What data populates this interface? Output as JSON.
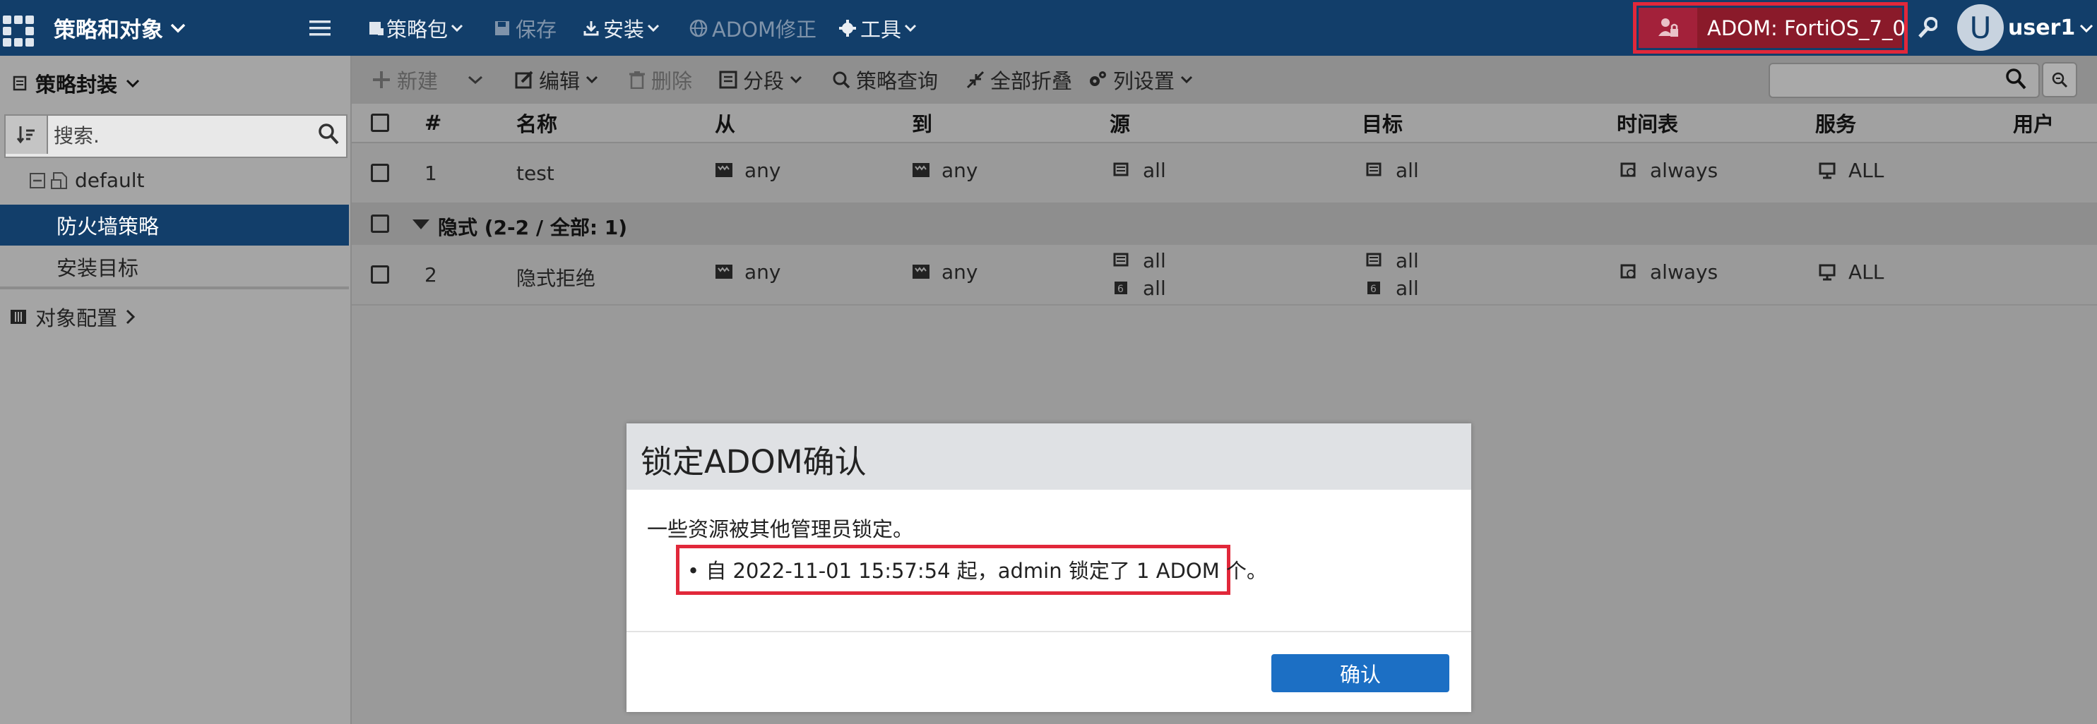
{
  "app": {
    "title": "策略和对象",
    "adom_label": "ADOM: FortiOS_7_0",
    "user_initial": "U",
    "user_name": "user1"
  },
  "topnav": {
    "policy_package": "策略包",
    "save": "保存",
    "install": "安装",
    "adom_revision": "ADOM修正",
    "tools": "工具"
  },
  "sidebar": {
    "header": "策略封装",
    "search_placeholder": "搜索.",
    "tree_default": "default",
    "items": [
      {
        "label": "防火墙策略",
        "active": true
      },
      {
        "label": "安装目标",
        "active": false
      }
    ],
    "object_config": "对象配置"
  },
  "toolbar": {
    "new": "新建",
    "edit": "编辑",
    "delete": "删除",
    "section": "分段",
    "policy_lookup": "策略查询",
    "collapse_all": "全部折叠",
    "column_settings": "列设置"
  },
  "table": {
    "headers": {
      "num": "#",
      "name": "名称",
      "from": "从",
      "to": "到",
      "source": "源",
      "dest": "目标",
      "schedule": "时间表",
      "service": "服务",
      "user": "用户"
    },
    "rows": [
      {
        "num": "1",
        "name": "test",
        "from": "any",
        "to": "any",
        "source": [
          "all"
        ],
        "dest": [
          "all"
        ],
        "schedule": "always",
        "service": "ALL"
      }
    ],
    "section": {
      "label": "隐式 (2-2 / 全部: 1)"
    },
    "implicit_rows": [
      {
        "num": "2",
        "name": "隐式拒绝",
        "from": "any",
        "to": "any",
        "source": [
          "all",
          "all"
        ],
        "dest": [
          "all",
          "all"
        ],
        "schedule": "always",
        "service": "ALL"
      }
    ]
  },
  "dialog": {
    "title": "锁定ADOM确认",
    "message": "一些资源被其他管理员锁定。",
    "bullet": "• 自 2022-11-01 15:57:54 起，admin 锁定了 1 ADOM 个。",
    "confirm": "确认"
  },
  "colors": {
    "topbar": "#123e6a",
    "highlight": "#e1283a",
    "primary_button": "#1c6fc4",
    "active_item": "#123e6a"
  }
}
